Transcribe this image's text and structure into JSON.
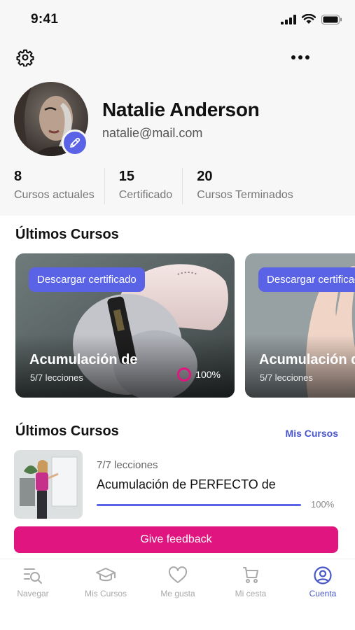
{
  "status_bar": {
    "time": "9:41"
  },
  "header": {
    "settings_icon": "gear-icon",
    "more_icon": "ellipsis-icon"
  },
  "profile": {
    "name": "Natalie Anderson",
    "email": "natalie@mail.com",
    "edit_icon": "pencil-icon"
  },
  "stats": [
    {
      "value": "8",
      "label": "Cursos actuales"
    },
    {
      "value": "15",
      "label": "Certificado"
    },
    {
      "value": "20",
      "label": "Cursos Terminados"
    }
  ],
  "carousel_section": {
    "title": "Últimos Cursos",
    "cards": [
      {
        "button": "Descargar certificado",
        "title": "Acumulación de",
        "lessons": "5/7 lecciones",
        "progress": "100%"
      },
      {
        "button": "Descargar certificado",
        "title": "Acumulación de",
        "lessons": "5/7 lecciones"
      }
    ]
  },
  "list_section": {
    "title": "Últimos Cursos",
    "link": "Mis Cursos",
    "items": [
      {
        "lessons": "7/7 lecciones",
        "title": "Acumulación de PERFECTO de",
        "progress_label": "100%",
        "progress": 1.0
      }
    ]
  },
  "feedback_button": "Give feedback",
  "tab_bar": [
    {
      "label": "Navegar",
      "icon": "search-list-icon",
      "active": false
    },
    {
      "label": "Mis Cursos",
      "icon": "graduation-cap-icon",
      "active": false
    },
    {
      "label": "Me gusta",
      "icon": "heart-icon",
      "active": false
    },
    {
      "label": "Mi cesta",
      "icon": "cart-icon",
      "active": false
    },
    {
      "label": "Cuenta",
      "icon": "user-circle-icon",
      "active": true
    }
  ],
  "colors": {
    "accent": "#5a63e6",
    "pink": "#e0157f",
    "link": "#4856c9"
  }
}
